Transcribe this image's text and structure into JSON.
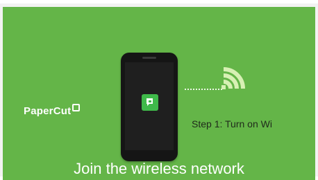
{
  "brand": {
    "name": "PaperCut"
  },
  "step": {
    "label": "Step 1:  Turn on Wi"
  },
  "caption": {
    "text": "Join the wireless network"
  },
  "icons": {
    "wifi": "wifi-signal-icon",
    "app": "papercut-app-icon",
    "phone": "smartphone-icon"
  },
  "colors": {
    "background": "#64b548",
    "wifi": "#d7f0b4",
    "app_icon": "#3fb94a"
  }
}
